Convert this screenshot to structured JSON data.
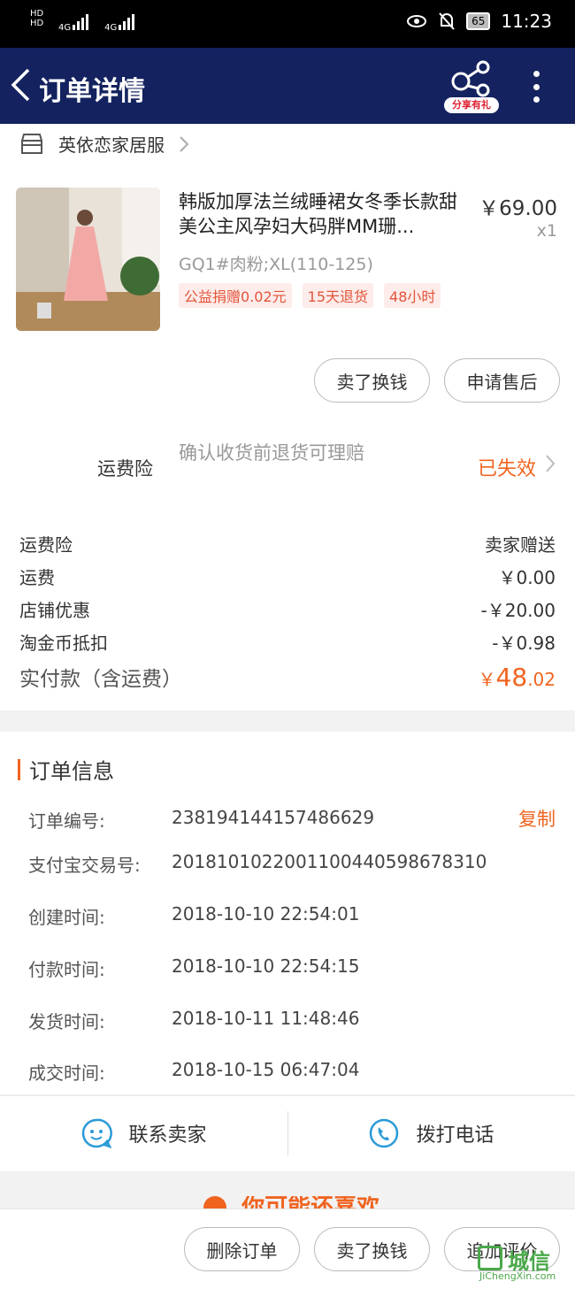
{
  "status_bar": {
    "network1": "4G",
    "network2": "4G",
    "hd1": "HD",
    "hd2": "HD",
    "battery": "65",
    "time": "11:23"
  },
  "nav": {
    "title": "订单详情",
    "share_label": "分享有礼"
  },
  "shop": {
    "name": "英依恋家居服"
  },
  "product": {
    "name": "韩版加厚法兰绒睡裙女冬季长款甜美公主风孕妇大码胖MM珊...",
    "price": "￥69.00",
    "quantity": "x1",
    "sku": "GQ1#肉粉;XL(110-125)",
    "tags": [
      "公益捐赠0.02元",
      "15天退货",
      "48小时"
    ]
  },
  "item_actions": {
    "sell": "卖了换钱",
    "after_sale": "申请售后"
  },
  "insurance": {
    "label": "运费险",
    "desc": "确认收货前退货可理赔",
    "status": "已失效"
  },
  "fees": [
    {
      "label": "运费险",
      "value": "卖家赠送"
    },
    {
      "label": "运费",
      "value": "￥0.00"
    },
    {
      "label": "店铺优惠",
      "value": "-￥20.00"
    },
    {
      "label": "淘金币抵扣",
      "value": "-￥0.98"
    }
  ],
  "total": {
    "label": "实付款（含运费）",
    "currency": "￥",
    "integer": "48",
    "decimal": ".02"
  },
  "order_info": {
    "title": "订单信息",
    "copy_label": "复制",
    "rows": [
      {
        "label": "订单编号:",
        "value": "238194144157486629"
      },
      {
        "label": "支付宝交易号:",
        "value": "2018101022001100440598678310"
      },
      {
        "label": "创建时间:",
        "value": "2018-10-10 22:54:01"
      },
      {
        "label": "付款时间:",
        "value": "2018-10-10 22:54:15"
      },
      {
        "label": "发货时间:",
        "value": "2018-10-11 11:48:46"
      },
      {
        "label": "成交时间:",
        "value": "2018-10-15 06:47:04"
      }
    ]
  },
  "contact": {
    "seller": "联系卖家",
    "call": "拨打电话"
  },
  "recommend": {
    "partial_title": "你可能还喜欢"
  },
  "footer": {
    "delete": "删除订单",
    "sell": "卖了换钱",
    "review": "追加评价"
  },
  "watermark": {
    "text": "城信",
    "url": "JiChengXin.com"
  },
  "colors": {
    "nav_bg": "#14235f",
    "accent": "#f06420",
    "icon_blue": "#2a9ad8"
  }
}
